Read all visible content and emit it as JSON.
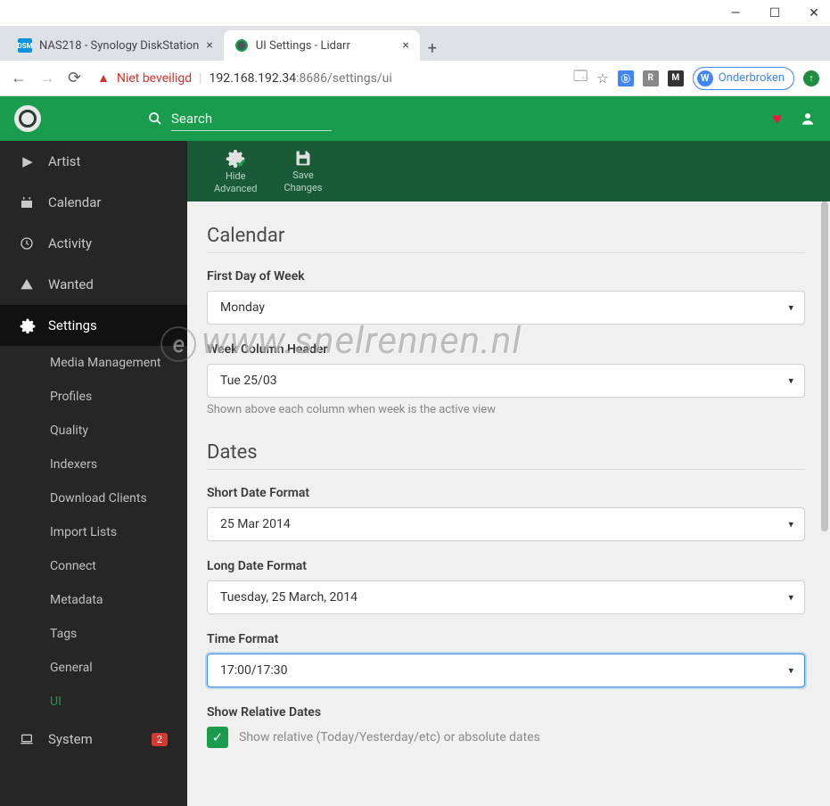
{
  "window": {
    "min": "—",
    "max": "☐",
    "close": "✕"
  },
  "tabs": [
    {
      "favicon": "dsm",
      "title": "NAS218 - Synology DiskStation"
    },
    {
      "favicon": "lidarr",
      "title": "UI Settings - Lidarr"
    }
  ],
  "addressbar": {
    "warning": "Niet beveiligd",
    "host": "192.168.192.34",
    "port": ":8686",
    "path": "/settings/ui",
    "profile_initial": "W",
    "profile_label": "Onderbroken"
  },
  "header": {
    "search_placeholder": "Search"
  },
  "sidebar": {
    "items": [
      {
        "icon": "play",
        "label": "Artist"
      },
      {
        "icon": "calendar",
        "label": "Calendar"
      },
      {
        "icon": "clock",
        "label": "Activity"
      },
      {
        "icon": "warning",
        "label": "Wanted"
      },
      {
        "icon": "gear",
        "label": "Settings",
        "active": true
      },
      {
        "icon": "laptop",
        "label": "System",
        "badge": "2"
      }
    ],
    "settings_sub": [
      "Media Management",
      "Profiles",
      "Quality",
      "Indexers",
      "Download Clients",
      "Import Lists",
      "Connect",
      "Metadata",
      "Tags",
      "General",
      "UI"
    ],
    "active_sub": "UI"
  },
  "toolbar": {
    "hide_advanced": "Hide Advanced",
    "save_changes": "Save Changes"
  },
  "sections": {
    "calendar": {
      "title": "Calendar",
      "first_day_label": "First Day of Week",
      "first_day_value": "Monday",
      "week_header_label": "Week Column Header",
      "week_header_value": "Tue 25/03",
      "week_header_help": "Shown above each column when week is the active view"
    },
    "dates": {
      "title": "Dates",
      "short_date_label": "Short Date Format",
      "short_date_value": "25 Mar 2014",
      "long_date_label": "Long Date Format",
      "long_date_value": "Tuesday, 25 March, 2014",
      "time_format_label": "Time Format",
      "time_format_value": "17:00/17:30",
      "relative_label": "Show Relative Dates",
      "relative_help": "Show relative (Today/Yesterday/etc) or absolute dates"
    }
  },
  "watermark": "www.snelrennen.nl"
}
